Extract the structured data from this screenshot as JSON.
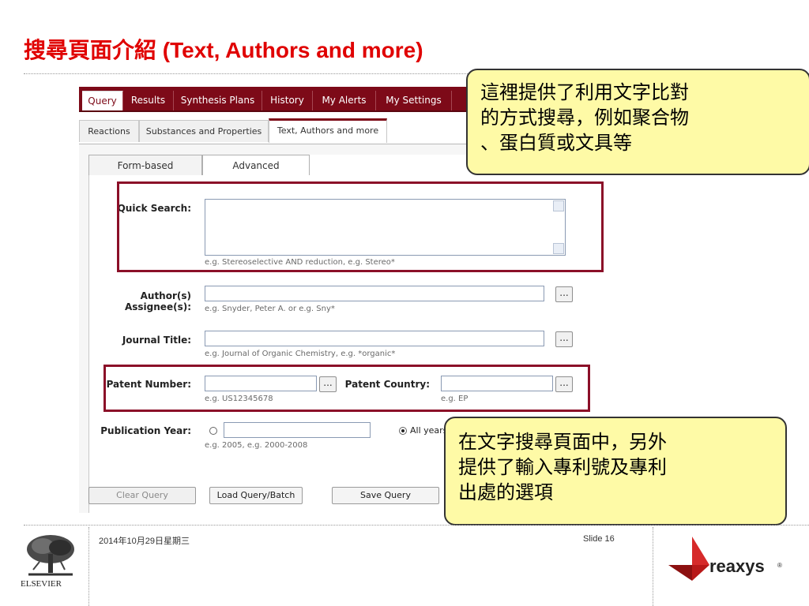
{
  "slide": {
    "title": "搜尋頁面介紹 (Text, Authors and more)",
    "date": "2014年10月29日星期三",
    "slide_number": "Slide 16",
    "brand_left": "ELSEVIER",
    "brand_right": "reaxys",
    "brand_right_mark": "®"
  },
  "app": {
    "menu": [
      "Query",
      "Results",
      "Synthesis Plans",
      "History",
      "My Alerts",
      "My Settings"
    ],
    "subtabs": [
      "Reactions",
      "Substances and Properties",
      "Text, Authors and more"
    ],
    "form_tabs": [
      "Form-based",
      "Advanced"
    ],
    "quick_search": {
      "label": "Quick Search:",
      "value": "",
      "hint": "e.g. Stereoselective AND reduction, e.g. Stereo*"
    },
    "authors": {
      "label1": "Author(s)",
      "label2": "Assignee(s):",
      "value": "",
      "hint": "e.g. Snyder, Peter A. or e.g. Sny*",
      "button": "..."
    },
    "journal": {
      "label": "Journal Title:",
      "value": "",
      "hint": "e.g. Journal of Organic Chemistry, e.g. *organic*",
      "button": "..."
    },
    "patent_number": {
      "label": "Patent Number:",
      "value": "",
      "hint": "e.g. US12345678",
      "button": "..."
    },
    "patent_country": {
      "label": "Patent Country:",
      "value": "",
      "hint": "e.g. EP",
      "button": "..."
    },
    "publication_year": {
      "label": "Publication Year:",
      "value": "",
      "hint": "e.g. 2005, e.g. 2000-2008",
      "all_years": "All years"
    },
    "buttons": [
      "Clear Query",
      "Load Query/Batch",
      "Save Query"
    ]
  },
  "callouts": {
    "top": [
      "這裡提供了利用文字比對",
      "的方式搜尋，例如聚合物",
      "、蛋白質或文具等"
    ],
    "bottom": [
      "在文字搜尋頁面中，另外",
      "提供了輸入專利號及專利",
      "出處的選項"
    ]
  },
  "colors": {
    "title_red": "#e00000",
    "menu_maroon": "#7d0a18",
    "highlight_box": "#8b0f28",
    "callout_fill": "#fefaa6"
  }
}
